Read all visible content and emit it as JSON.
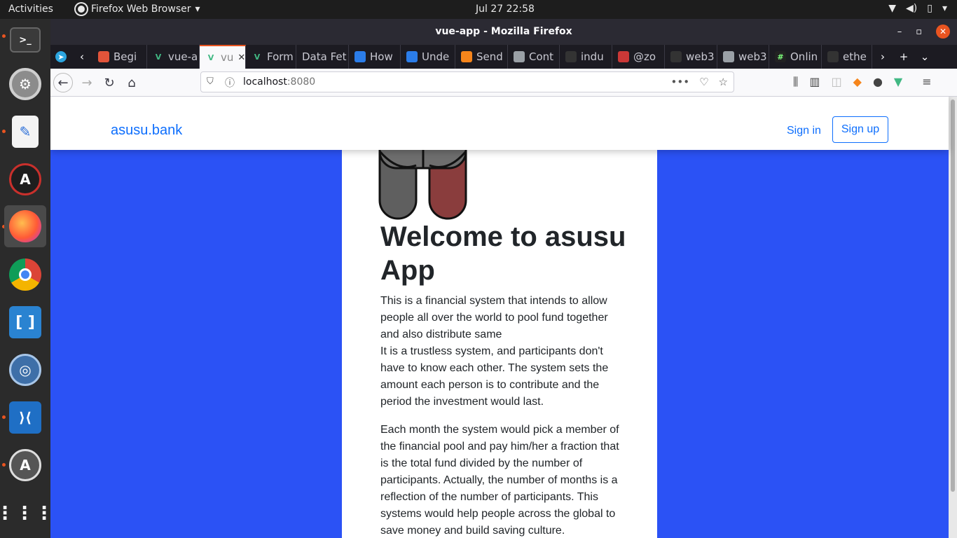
{
  "system": {
    "activities": "Activities",
    "app_menu": "Firefox Web Browser",
    "clock": "Jul 27  22:58"
  },
  "window": {
    "title": "vue-app - Mozilla Firefox"
  },
  "tabs": [
    {
      "label": "Begi",
      "icon": "orange-shield-icon",
      "color": "#e2543a"
    },
    {
      "label": "vue-a",
      "icon": "vue-icon",
      "color": "#41b883"
    },
    {
      "label": "vu",
      "icon": "vue-icon",
      "color": "#41b883",
      "selected": true
    },
    {
      "label": "Form",
      "icon": "vue-icon",
      "color": "#41b883"
    },
    {
      "label": "Data Fet",
      "icon": "",
      "color": ""
    },
    {
      "label": "How",
      "icon": "blue-swirl-icon",
      "color": "#2b7de9"
    },
    {
      "label": "Unde",
      "icon": "blue-swirl-icon",
      "color": "#2b7de9"
    },
    {
      "label": "Send",
      "icon": "metamask-icon",
      "color": "#f6851b"
    },
    {
      "label": "Cont",
      "icon": "document-icon",
      "color": "#9aa0a6"
    },
    {
      "label": "indu",
      "icon": "github-icon",
      "color": "#333333"
    },
    {
      "label": "@zo",
      "icon": "npm-icon",
      "color": "#cb3837"
    },
    {
      "label": "web3",
      "icon": "github-icon",
      "color": "#333333"
    },
    {
      "label": "web3",
      "icon": "document-icon",
      "color": "#9aa0a6"
    },
    {
      "label": "Onlin",
      "icon": "hash-icon",
      "color": "#222222"
    },
    {
      "label": "ethe",
      "icon": "github-icon",
      "color": "#333333"
    }
  ],
  "urlbar": {
    "host": "localhost",
    "port": ":8080"
  },
  "site": {
    "brand": "asusu.bank",
    "sign_in": "Sign in",
    "sign_up": "Sign up",
    "heading": "Welcome to asusu App",
    "paragraph1_line1": "This is a financial system that intends to allow people all over the world to pool fund together and also distribute same",
    "paragraph1_line2": "It is a trustless system, and participants don't have to know each other. The system sets the amount each person is to contribute and the period the investment would last.",
    "paragraph2": "Each month the system would pick a member of the financial pool and pay him/her a fraction that is the total fund divided by the number of participants. Actually, the number of months is a reflection of the number of participants. This systems would help people across the global to save money and build saving culture."
  },
  "colors": {
    "accent": "#0d6efd",
    "page_background": "#2b52f5",
    "ubuntu_orange": "#e95420"
  }
}
